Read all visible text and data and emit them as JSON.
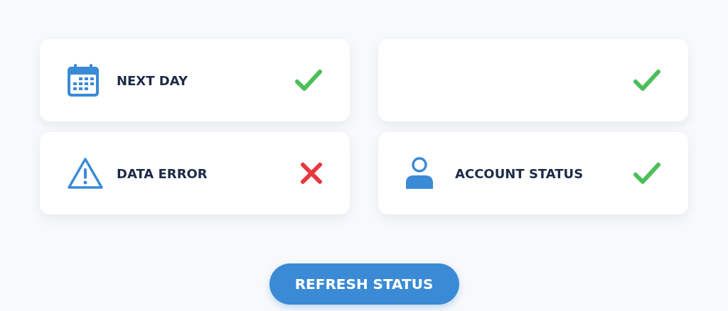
{
  "items": [
    {
      "kind": "calendar",
      "label": "NEXT DAY",
      "passed": true
    },
    {
      "kind": "blank",
      "passed": true
    },
    {
      "kind": "warning",
      "label": "DATA ERROR",
      "passed": false
    },
    {
      "kind": "person",
      "label": "ACCOUNT STATUS",
      "passed": true
    }
  ],
  "button": "REFRESH STATUS"
}
